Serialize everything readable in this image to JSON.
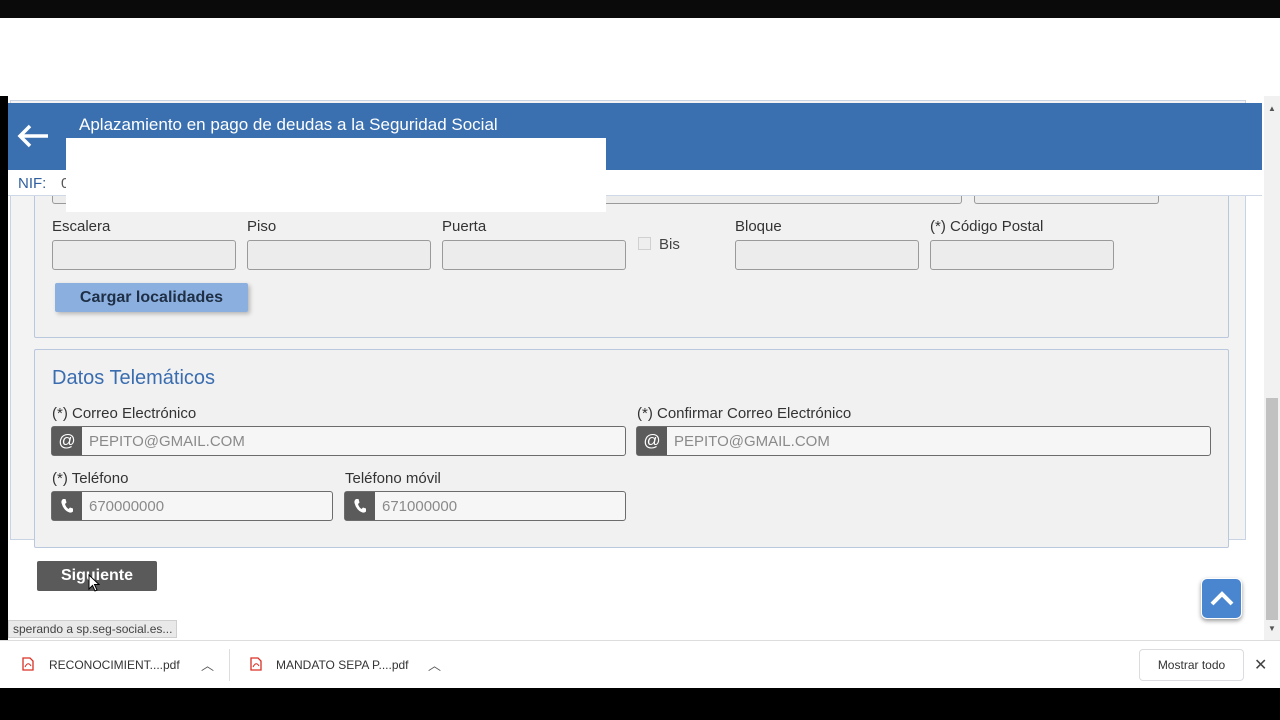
{
  "header": {
    "title": "Aplazamiento en pago de deudas a la Seguridad Social",
    "back_icon": "arrow-left-icon",
    "nif_label": "NIF:",
    "nif_value": "0"
  },
  "address": {
    "escalera_label": "Escalera",
    "piso_label": "Piso",
    "puerta_label": "Puerta",
    "bis_label": "Bis",
    "bloque_label": "Bloque",
    "codigo_postal_label": "(*) Código Postal",
    "cargar_button": "Cargar localidades"
  },
  "telematicos": {
    "title": "Datos Telemáticos",
    "email_label": "(*) Correo Electrónico",
    "email_value": "PEPITO@GMAIL.COM",
    "confirm_email_label": "(*) Confirmar Correo Electrónico",
    "confirm_email_value": "PEPITO@GMAIL.COM",
    "telefono_label": "(*) Teléfono",
    "telefono_value": "670000000",
    "movil_label": "Teléfono móvil",
    "movil_value": "671000000",
    "at_symbol": "@"
  },
  "actions": {
    "siguiente": "Siguiente"
  },
  "browser": {
    "status": "sperando a sp.seg-social.es...",
    "downloads": [
      {
        "name": "RECONOCIMIENT....pdf"
      },
      {
        "name": "MANDATO SEPA P....pdf"
      }
    ],
    "mostrar_todo": "Mostrar todo",
    "close": "✕"
  },
  "colors": {
    "header_blue": "#3a70b0",
    "accent_blue": "#4a86cf",
    "button_light_blue": "#8bb0e0"
  }
}
